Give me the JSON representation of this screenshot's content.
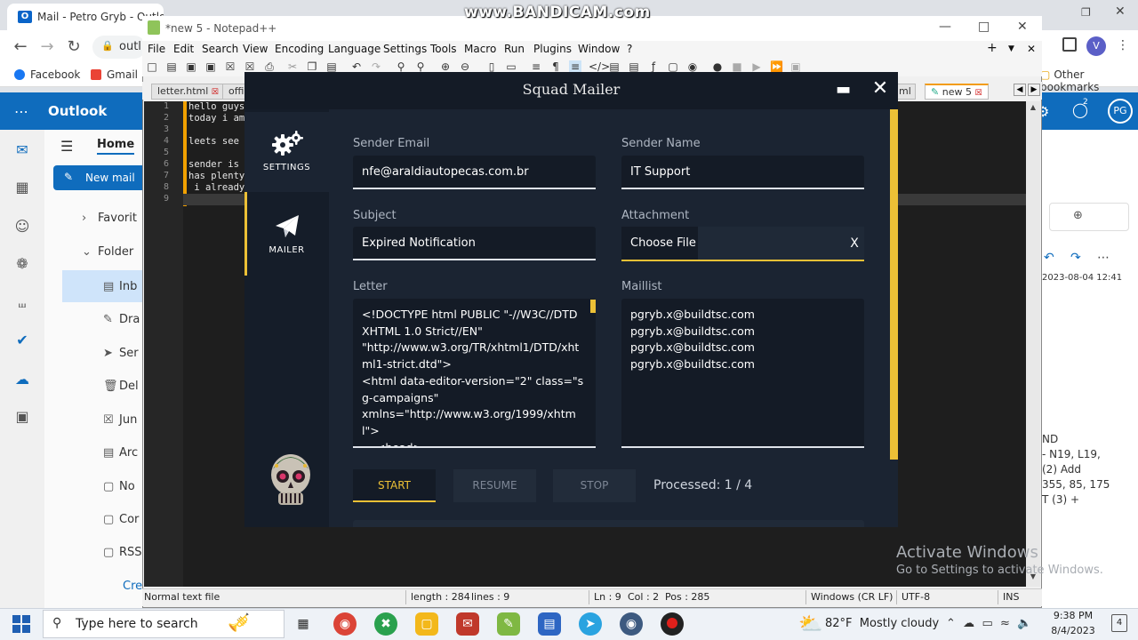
{
  "watermark": {
    "recorder": "www.BANDICAM.com"
  },
  "browser": {
    "tab_title": "Mail - Petro Gryb - Outlook",
    "omnibox_text": "outl",
    "profile_initial": "V",
    "bookmarks": [
      {
        "label": "Facebook",
        "color": "#1877f2"
      },
      {
        "label": "Gmail",
        "color": "#ea4335"
      }
    ],
    "other_bookmarks": "Other bookmarks"
  },
  "outlook": {
    "app_name": "Outlook",
    "home_tab": "Home",
    "new_mail": "New mail",
    "folders": [
      "Favorit",
      "Folder",
      "Inb",
      "Dra",
      "Ser",
      "Del",
      "Jun",
      "Arc",
      "No",
      "Cor",
      "RSS",
      "Cre"
    ],
    "avatar_initials": "PG",
    "notification_count": "2",
    "reading_date": "2023-08-04 12:41",
    "reading_snippet": [
      "ND",
      "- N19, L19,",
      "(2) Add",
      "355, 85, 175",
      "T (3) +"
    ]
  },
  "notepad": {
    "title": "*new 5 - Notepad++",
    "menu": [
      "File",
      "Edit",
      "Search",
      "View",
      "Encoding",
      "Language",
      "Settings",
      "Tools",
      "Macro",
      "Run",
      "Plugins",
      "Window",
      "?"
    ],
    "tabs": [
      "letter.html",
      "offic",
      "ml",
      "new 5"
    ],
    "lines": [
      "hello guys",
      "today i am",
      "",
      "leets see",
      "",
      "sender is",
      "has plenty",
      " i already",
      ""
    ],
    "status": {
      "file_type": "Normal text file",
      "length": "length : 284",
      "lines": "lines : 9",
      "ln": "Ln : 9",
      "col": "Col : 2",
      "pos": "Pos : 285",
      "eol": "Windows (CR LF)",
      "encoding": "UTF-8",
      "mode": "INS"
    }
  },
  "mailer": {
    "title": "Squad Mailer",
    "nav": {
      "settings": "SETTINGS",
      "mailer": "MAILER"
    },
    "fields": {
      "sender_email_label": "Sender Email",
      "sender_email": "nfe@araldiautopecas.com.br",
      "sender_name_label": "Sender Name",
      "sender_name": "IT Support",
      "subject_label": "Subject",
      "subject": "Expired Notification",
      "attachment_label": "Attachment",
      "choose_file": "Choose File",
      "clear": "X",
      "letter_label": "Letter",
      "letter": "<!DOCTYPE html PUBLIC \"-//W3C//DTD XHTML 1.0 Strict//EN\"\n\"http://www.w3.org/TR/xhtml1/DTD/xhtml1-strict.dtd\">\n<html data-editor-version=\"2\" class=\"sg-campaigns\"\nxmlns=\"http://www.w3.org/1999/xhtml\">\n    <head>\n      <meta http-equiv=\"Content-Type\"",
      "maillist_label": "Maillist",
      "maillist": "pgryb.x@buildtsc.com\npgryb.x@buildtsc.com\npgryb.x@buildtsc.com\npgryb.x@buildtsc.com"
    },
    "buttons": {
      "start": "START",
      "resume": "RESUME",
      "stop": "STOP"
    },
    "processed": "Processed: 1 / 4",
    "accent": "#ecc036"
  },
  "windows": {
    "activate_title": "Activate Windows",
    "activate_sub": "Go to Settings to activate Windows.",
    "search_placeholder": "Type here to search",
    "temperature": "82°F",
    "weather": "Mostly cloudy",
    "time": "9:38 PM",
    "date": "8/4/2023",
    "notifications": "4"
  }
}
